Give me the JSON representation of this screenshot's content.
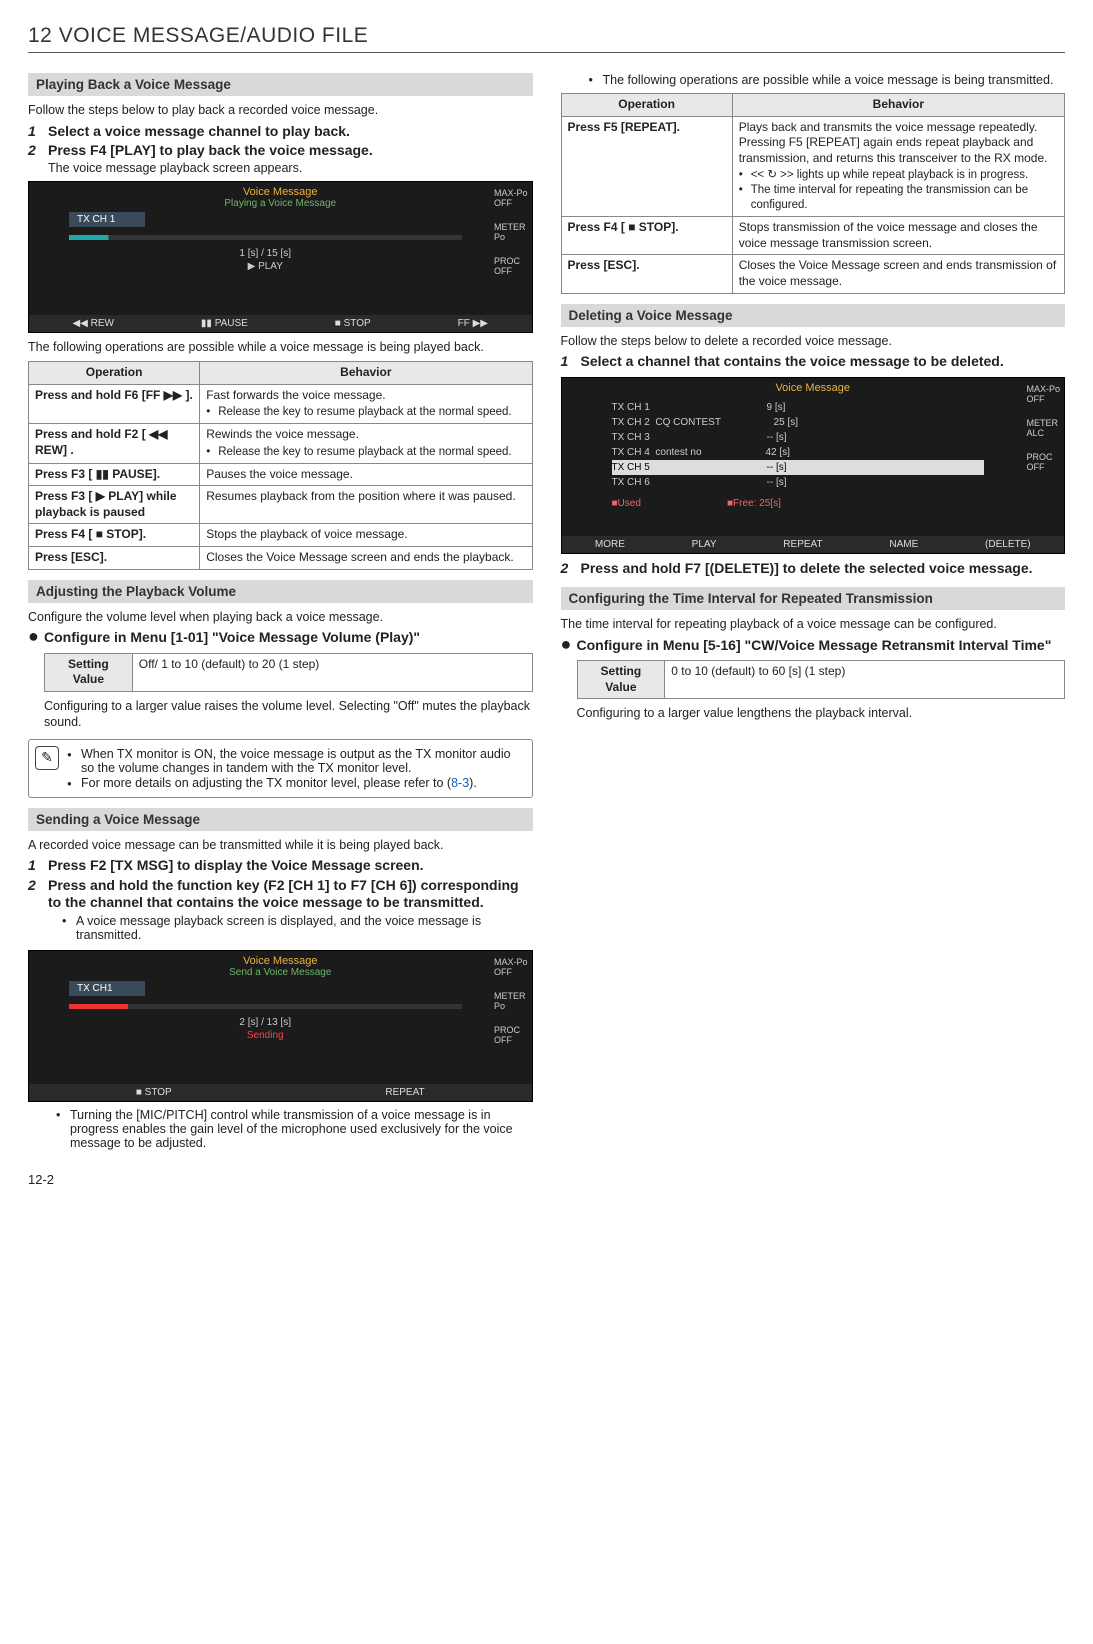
{
  "page": {
    "title": "12 VOICE MESSAGE/AUDIO FILE",
    "number": "12-2"
  },
  "left": {
    "playing_back": {
      "heading": "Playing Back a Voice Message",
      "intro": "Follow the steps below to play back a recorded voice message.",
      "steps": [
        {
          "n": "1",
          "head": "Select a voice message channel to play back."
        },
        {
          "n": "2",
          "head": "Press F4 [PLAY] to play back the voice message.",
          "sub": "The voice message playback screen appears."
        }
      ],
      "ss": {
        "title": "Voice Message",
        "sub": "Playing a Voice Message",
        "ch": "TX CH 1",
        "time": "1 [s]   /   15 [s]",
        "state": "▶ PLAY",
        "side": [
          "MAX-Po\nOFF",
          "METER\nPo",
          "PROC\nOFF"
        ],
        "btns": [
          "◀◀ REW",
          "▮▮ PAUSE",
          "■ STOP",
          "FF ▶▶"
        ]
      },
      "after": "The following operations are possible while a voice message is being played back.",
      "table_h_op": "Operation",
      "table_h_be": "Behavior",
      "rows": [
        {
          "op": "Press and hold F6 [FF ▶▶ ].",
          "be": "Fast forwards the voice message.",
          "sub": "Release the key to resume playback at the normal speed."
        },
        {
          "op": "Press and hold F2 [ ◀◀ REW] .",
          "be": "Rewinds the voice message.",
          "sub": "Release the key to resume playback at the normal speed."
        },
        {
          "op": "Press F3 [ ▮▮ PAUSE].",
          "be": "Pauses the voice message."
        },
        {
          "op": "Press F3 [ ▶ PLAY] while playback is paused",
          "be": "Resumes playback from the position where it was paused."
        },
        {
          "op": "Press F4 [ ■ STOP].",
          "be": "Stops the playback of voice message."
        },
        {
          "op": "Press [ESC].",
          "be": "Closes the Voice Message screen and ends the playback."
        }
      ]
    },
    "adjust_vol": {
      "heading": "Adjusting the Playback Volume",
      "intro": "Configure the volume level when playing back a voice message.",
      "cfg": "Configure in Menu [1-01] \"Voice Message Volume (Play)\"",
      "sv_label": "Setting Value",
      "sv_val": "Off/ 1 to 10 (default) to 20 (1 step)",
      "after": "Configuring to a larger value raises the volume level. Selecting \"Off\" mutes the playback sound.",
      "notes": [
        "When TX monitor is ON, the voice message is output as the TX monitor audio so the volume changes in tandem with the TX monitor level.",
        "For more details on adjusting the TX monitor level, please refer to ("
      ],
      "note_link": "8-3",
      "note_tail": ")."
    },
    "sending": {
      "heading": "Sending a Voice Message",
      "intro": "A recorded voice message can be transmitted while it is being played back.",
      "steps": [
        {
          "n": "1",
          "head": "Press F2 [TX MSG] to display the Voice Message screen."
        },
        {
          "n": "2",
          "head": "Press and hold the function key (F2 [CH 1] to F7 [CH 6]) corresponding to the channel that contains the voice message to be transmitted.",
          "bullets": [
            "A voice message playback screen is displayed, and the voice message is transmitted."
          ]
        }
      ],
      "ss": {
        "title": "Voice Message",
        "sub": "Send a Voice Message",
        "ch": "TX CH1",
        "time": "2 [s]   /   13 [s]",
        "state": "Sending",
        "side": [
          "MAX-Po\nOFF",
          "METER\nPo",
          "PROC\nOFF"
        ],
        "btns": [
          "",
          "",
          "■ STOP",
          "REPEAT",
          ""
        ]
      },
      "after_bullets": [
        "Turning the [MIC/PITCH] control while transmission of a voice message is in progress enables the gain level of the microphone used exclusively for the voice message to be adjusted."
      ]
    }
  },
  "right": {
    "top_bullets": [
      "The following operations are possible while a voice message is being transmitted."
    ],
    "table_h_op": "Operation",
    "table_h_be": "Behavior",
    "rows": [
      {
        "op": "Press F5 [REPEAT].",
        "be": "Plays back and transmits the voice message repeatedly. Pressing F5 [REPEAT] again ends repeat playback and transmission, and returns this transceiver to the RX mode.",
        "subs": [
          "<< ↻ >> lights up while repeat playback is in progress.",
          "The time interval for repeating the transmission can be configured."
        ]
      },
      {
        "op": "Press F4 [ ■ STOP].",
        "be": "Stops transmission of the voice message and closes the voice message transmission screen."
      },
      {
        "op": "Press [ESC].",
        "be": "Closes the Voice Message screen and ends transmission of the voice message."
      }
    ],
    "deleting": {
      "heading": "Deleting a Voice Message",
      "intro": "Follow the steps below to delete a recorded voice message.",
      "steps": [
        {
          "n": "1",
          "head": "Select a channel that contains the voice message to be deleted."
        }
      ],
      "ss": {
        "title": "Voice Message",
        "rows": [
          "TX CH 1                                          9 [s]",
          "TX CH 2  CQ CONTEST                   25 [s]",
          "TX CH 3                                          -- [s]",
          "TX CH 4  contest no                       42 [s]",
          "TX CH 5                                          -- [s]",
          "TX CH 6                                          -- [s]"
        ],
        "footer": "■Used                               ■Free: 25[s]",
        "side": [
          "MAX-Po\nOFF",
          "METER\nALC",
          "PROC\nOFF"
        ],
        "btns": [
          "MORE",
          "",
          "",
          "PLAY",
          "REPEAT",
          "NAME",
          "(DELETE)"
        ]
      },
      "step2": {
        "n": "2",
        "head": "Press and hold F7 [(DELETE)] to delete the selected voice message."
      }
    },
    "time_interval": {
      "heading": "Configuring the Time Interval for Repeated Transmission",
      "intro": "The time interval for repeating playback of a voice message can be configured.",
      "cfg": "Configure in Menu [5-16] \"CW/Voice Message Retransmit Interval Time\"",
      "sv_label": "Setting Value",
      "sv_val": "0 to 10 (default) to 60 [s] (1 step)",
      "after": "Configuring to a larger value lengthens the playback interval."
    }
  }
}
